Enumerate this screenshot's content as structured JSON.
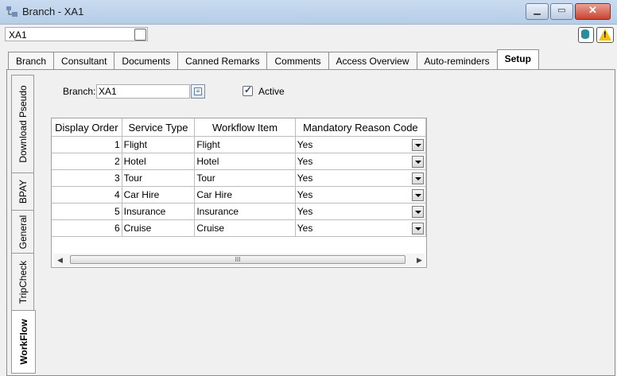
{
  "window": {
    "title": "Branch - XA1"
  },
  "record": {
    "code": "XA1"
  },
  "tabs": [
    {
      "label": "Branch"
    },
    {
      "label": "Consultant"
    },
    {
      "label": "Documents"
    },
    {
      "label": "Canned Remarks"
    },
    {
      "label": "Comments"
    },
    {
      "label": "Access Overview"
    },
    {
      "label": "Auto-reminders"
    },
    {
      "label": "Setup",
      "active": true
    }
  ],
  "side_tabs": [
    {
      "label": "Download Pseudo"
    },
    {
      "label": "BPAY"
    },
    {
      "label": "General"
    },
    {
      "label": "TripCheck"
    },
    {
      "label": "WorkFlow",
      "active": true
    }
  ],
  "form": {
    "branch_label": "Branch:",
    "branch_value": "XA1",
    "active_label": "Active",
    "active_checked": true
  },
  "grid": {
    "columns": [
      "Display Order",
      "Service Type",
      "Workflow Item",
      "Mandatory Reason Code"
    ],
    "rows": [
      {
        "order": "1",
        "service": "Flight",
        "workflow": "Flight",
        "mandatory": "Yes"
      },
      {
        "order": "2",
        "service": "Hotel",
        "workflow": "Hotel",
        "mandatory": "Yes"
      },
      {
        "order": "3",
        "service": "Tour",
        "workflow": "Tour",
        "mandatory": "Yes"
      },
      {
        "order": "4",
        "service": "Car Hire",
        "workflow": "Car Hire",
        "mandatory": "Yes"
      },
      {
        "order": "5",
        "service": "Insurance",
        "workflow": "Insurance",
        "mandatory": "Yes"
      },
      {
        "order": "6",
        "service": "Cruise",
        "workflow": "Cruise",
        "mandatory": "Yes"
      }
    ],
    "scroll_thumb": "III"
  },
  "icons": {
    "title": "branch-window-icon",
    "minimize": "minimize-icon",
    "maximize": "maximize-icon",
    "close": "close-icon",
    "database": "database-icon",
    "warning": "warning-icon"
  }
}
